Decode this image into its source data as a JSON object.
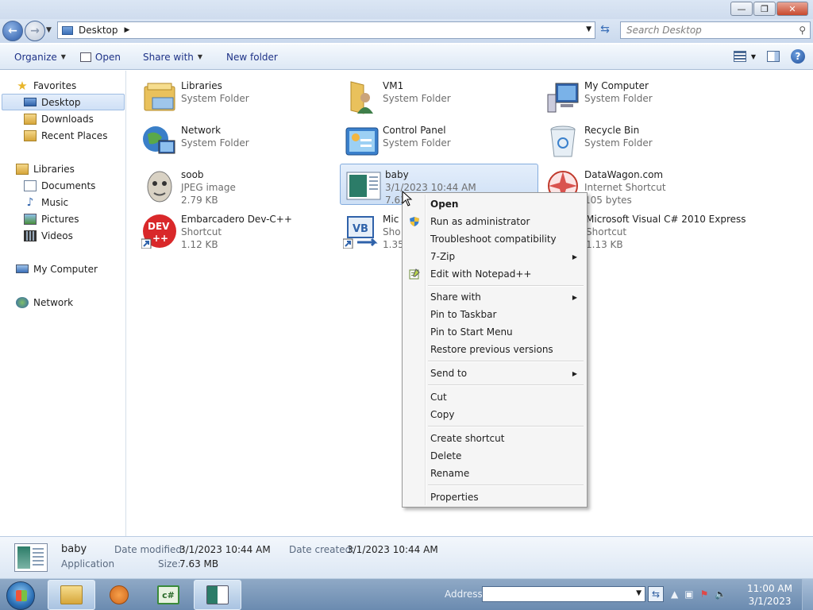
{
  "window": {
    "controls": {
      "minimize": "—",
      "maximize": "❐",
      "close": "✕"
    }
  },
  "address": {
    "location": "Desktop",
    "search_placeholder": "Search Desktop"
  },
  "commands": {
    "organize": "Organize",
    "open": "Open",
    "share_with": "Share with",
    "new_folder": "New folder"
  },
  "sidebar": {
    "favorites": "Favorites",
    "desktop": "Desktop",
    "downloads": "Downloads",
    "recent_places": "Recent Places",
    "libraries": "Libraries",
    "documents": "Documents",
    "music": "Music",
    "pictures": "Pictures",
    "videos": "Videos",
    "my_computer": "My Computer",
    "network": "Network"
  },
  "files": [
    {
      "name": "Libraries",
      "line2": "System Folder",
      "line3": "",
      "icon": "libraries-icon"
    },
    {
      "name": "VM1",
      "line2": "System Folder",
      "line3": "",
      "icon": "user-folder-icon"
    },
    {
      "name": "My Computer",
      "line2": "System Folder",
      "line3": "",
      "icon": "computer-icon"
    },
    {
      "name": "Network",
      "line2": "System Folder",
      "line3": "",
      "icon": "network-icon"
    },
    {
      "name": "Control Panel",
      "line2": "System Folder",
      "line3": "",
      "icon": "control-panel-icon"
    },
    {
      "name": "Recycle Bin",
      "line2": "System Folder",
      "line3": "",
      "icon": "recycle-bin-icon"
    },
    {
      "name": "soob",
      "line2": "JPEG image",
      "line3": "2.79 KB",
      "icon": "image-icon"
    },
    {
      "name": "baby",
      "line2": "3/1/2023 10:44 AM",
      "line3": "7.63",
      "icon": "application-icon"
    },
    {
      "name": "DataWagon.com",
      "line2": "Internet Shortcut",
      "line3": "105 bytes",
      "icon": "internet-shortcut-icon"
    },
    {
      "name": "Embarcadero Dev-C++",
      "line2": "Shortcut",
      "line3": "1.12 KB",
      "icon": "devcpp-icon"
    },
    {
      "name": "Mic",
      "line2": "Sho",
      "line3": "1.35",
      "icon": "visual-basic-icon"
    },
    {
      "name": "Microsoft Visual C# 2010 Express",
      "line2": "Shortcut",
      "line3": "1.13 KB",
      "icon": "visual-csharp-icon"
    }
  ],
  "context_menu": {
    "open": "Open",
    "run_as_admin": "Run as administrator",
    "troubleshoot": "Troubleshoot compatibility",
    "seven_zip": "7-Zip",
    "edit_notepad": "Edit with Notepad++",
    "share_with": "Share with",
    "pin_taskbar": "Pin to Taskbar",
    "pin_start": "Pin to Start Menu",
    "restore_versions": "Restore previous versions",
    "send_to": "Send to",
    "cut": "Cut",
    "copy": "Copy",
    "create_shortcut": "Create shortcut",
    "delete": "Delete",
    "rename": "Rename",
    "properties": "Properties"
  },
  "details": {
    "name": "baby",
    "type": "Application",
    "date_modified_label": "Date modified:",
    "date_modified": "3/1/2023 10:44 AM",
    "date_created_label": "Date created:",
    "date_created": "3/1/2023 10:44 AM",
    "size_label": "Size:",
    "size": "7.63 MB"
  },
  "taskbar": {
    "address_label": "Address",
    "time": "11:00 AM",
    "date": "3/1/2023"
  },
  "colors": {
    "selection": "#cddff5",
    "accent": "#1e3287"
  }
}
